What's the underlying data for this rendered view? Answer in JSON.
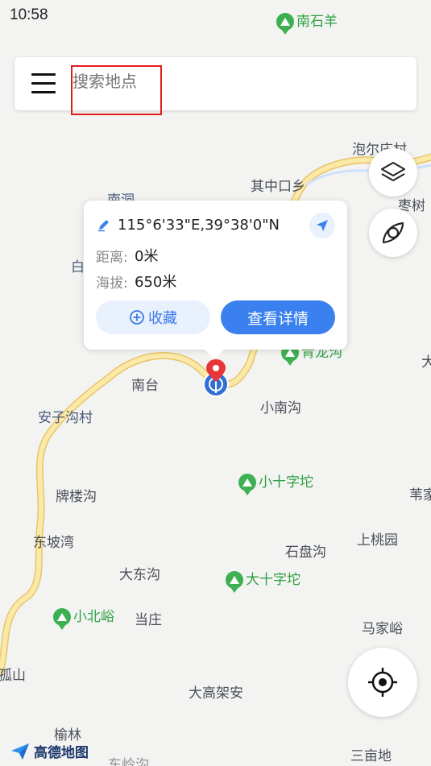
{
  "status_bar": {
    "time": "10:58"
  },
  "search": {
    "placeholder": "搜索地点"
  },
  "popup": {
    "coordinates": "115°6'33\"E,39°38'0\"N",
    "distance_label": "距离:",
    "distance_value": "0米",
    "altitude_label": "海拔:",
    "altitude_value": "650米",
    "favorite_label": "收藏",
    "detail_label": "查看详情"
  },
  "map_labels": {
    "paoer_cun": "泡尔庄村",
    "qizhongkou": "其中口乡",
    "zaoshu": "枣树",
    "nanhe": "南洞",
    "bai": "白",
    "nantai": "南台",
    "anzigou": "安子沟村",
    "xiaonangou": "小南沟",
    "pailougou": "牌楼沟",
    "dongpowan": "东坡湾",
    "dadonggou": "大东沟",
    "shipangou": "石盘沟",
    "shangtaoyuan": "上桃园",
    "dangzhuang": "当庄",
    "majiayu": "马家峪",
    "gushan": "孤山",
    "dagaojiaan": "大高架安",
    "yulin": "榆林",
    "sanmudi": "三亩地",
    "da": "大",
    "tijia": "苇家",
    "bottom_cut": "东岭沟"
  },
  "pois": {
    "nanshiyang": "南石羊",
    "qinglonggou": "青龙沟",
    "xiaoshizituo": "小十字坨",
    "dashizituo": "大十字坨",
    "xiaobeiyu": "小北峪"
  },
  "logo": {
    "text": "高德地图"
  },
  "icons": {
    "menu": "menu-icon",
    "layers": "layers-icon",
    "compass": "compass-icon",
    "locate": "locate-icon",
    "edit": "edit-icon",
    "navigate": "navigate-icon",
    "add": "add-circle-icon"
  },
  "colors": {
    "accent": "#3a80ee",
    "poi_green": "#3db052",
    "road_yellow": "#f2d88b",
    "river_blue": "#cfe0ff"
  }
}
